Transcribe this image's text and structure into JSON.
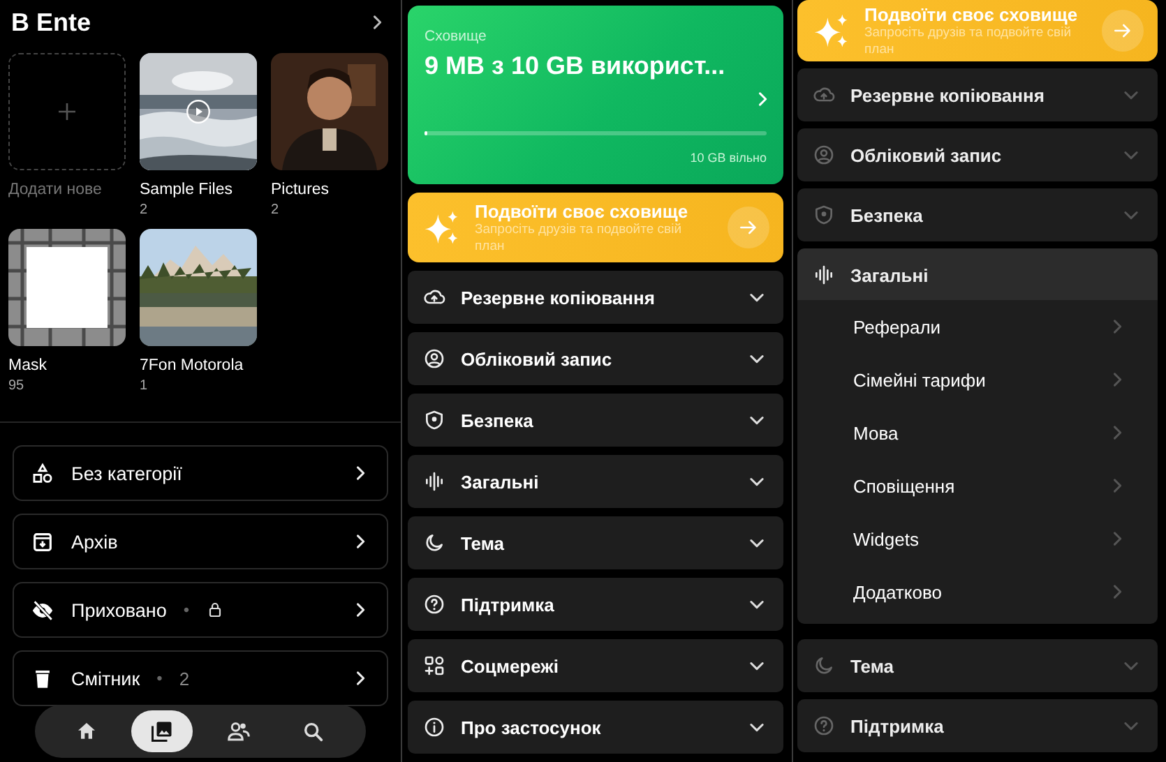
{
  "albums_screen": {
    "title": "В Ente",
    "albums": [
      {
        "kind": "add",
        "name": "Додати нове"
      },
      {
        "kind": "picture",
        "name": "Sample Files",
        "count": "2",
        "video": true
      },
      {
        "kind": "picture",
        "name": "Pictures",
        "count": "2",
        "video": false
      },
      {
        "kind": "picture",
        "name": "Mask",
        "count": "95",
        "video": false
      },
      {
        "kind": "picture",
        "name": "7Fon Motorola",
        "count": "1",
        "video": false
      }
    ],
    "collections": [
      {
        "label": "Без категорії",
        "locked": false
      },
      {
        "label": "Архів",
        "locked": false
      },
      {
        "label": "Приховано",
        "dot": "•",
        "locked": true
      },
      {
        "label": "Смітник",
        "dot": "•",
        "badge": "2",
        "locked": false
      }
    ],
    "nav": [
      {
        "selected": false
      },
      {
        "selected": true
      },
      {
        "selected": false
      },
      {
        "selected": false
      }
    ]
  },
  "settings_screen": {
    "storage": {
      "label": "Сховище",
      "usage": "9 MB з 10 GB використ...",
      "level": 0.01,
      "free": "10 GB вільно"
    },
    "promo": {
      "title": "Подвоїти своє сховище",
      "subtitle": "Запросіть друзів та подвойте свій план"
    },
    "sections": [
      {
        "label": "Резервне копіювання",
        "expanded": false
      },
      {
        "label": "Обліковий запис",
        "expanded": false
      },
      {
        "label": "Безпека",
        "expanded": false
      },
      {
        "label": "Загальні",
        "expanded": false
      },
      {
        "label": "Тема",
        "expanded": false
      },
      {
        "label": "Підтримка",
        "expanded": false
      },
      {
        "label": "Соцмережі",
        "expanded": false
      },
      {
        "label": "Про застосунок",
        "expanded": false
      }
    ]
  },
  "settings_expanded_screen": {
    "promo": {
      "title": "Подвоїти своє сховище",
      "subtitle": "Запросіть друзів та подвойте свій план"
    },
    "sections": [
      {
        "label": "Резервне копіювання",
        "expanded": false
      },
      {
        "label": "Обліковий запис",
        "expanded": false
      },
      {
        "label": "Безпека",
        "expanded": false
      },
      {
        "label": "Загальні",
        "expanded": true,
        "children": [
          {
            "label": "Реферали"
          },
          {
            "label": "Сімейні тарифи"
          },
          {
            "label": "Мова"
          },
          {
            "label": "Сповіщення"
          },
          {
            "label": "Widgets"
          },
          {
            "label": "Додатково"
          }
        ]
      },
      {
        "label": "Тема",
        "expanded": false
      },
      {
        "label": "Підтримка",
        "expanded": false
      }
    ]
  }
}
